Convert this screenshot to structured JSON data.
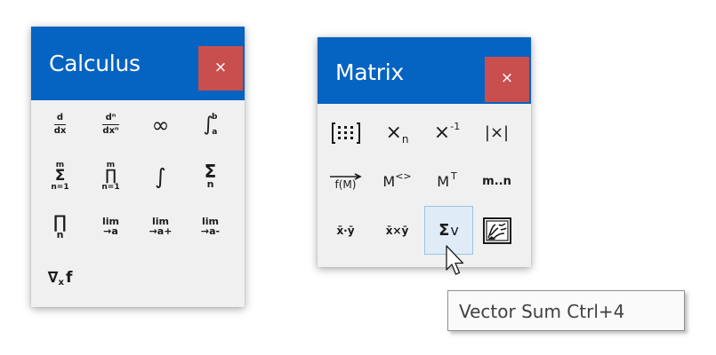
{
  "calculus": {
    "title": "Calculus",
    "close_glyph": "×",
    "buttons": [
      {
        "name": "derivative"
      },
      {
        "name": "nth-derivative"
      },
      {
        "name": "infinity"
      },
      {
        "name": "definite-integral"
      },
      {
        "name": "range-sum"
      },
      {
        "name": "range-product"
      },
      {
        "name": "indefinite-integral"
      },
      {
        "name": "summation"
      },
      {
        "name": "product"
      },
      {
        "name": "limit"
      },
      {
        "name": "right-limit"
      },
      {
        "name": "left-limit"
      },
      {
        "name": "gradient"
      }
    ],
    "glyphs": {
      "d": "d",
      "dx": "dx",
      "dn": "dⁿ",
      "dxn": "dxⁿ",
      "inf": "∞",
      "int": "∫",
      "b": "b",
      "a": "a",
      "m": "m",
      "n": "n",
      "neq1": "n=1",
      "sigma": "Σ",
      "pi": "∏",
      "lim": "lim",
      "to_a": "→a",
      "to_aplus": "→a+",
      "to_aminus": "→a-",
      "nabla": "∇",
      "x": "x",
      "f": "f"
    }
  },
  "matrix": {
    "title": "Matrix",
    "close_glyph": "×",
    "buttons": [
      {
        "name": "insert-matrix"
      },
      {
        "name": "subscript"
      },
      {
        "name": "inverse"
      },
      {
        "name": "determinant"
      },
      {
        "name": "vectorize"
      },
      {
        "name": "matrix-column"
      },
      {
        "name": "transpose"
      },
      {
        "name": "range-variable"
      },
      {
        "name": "dot-product"
      },
      {
        "name": "cross-product"
      },
      {
        "name": "vector-sum"
      },
      {
        "name": "picture"
      }
    ],
    "glyphs": {
      "xn_x": "×",
      "xn_n": "n",
      "inv_x": "×",
      "inv_sup": "-1",
      "det": "|×|",
      "fM": "f(M)",
      "M": "M",
      "col": "<>",
      "T": "T",
      "range": "m..n",
      "dot": "x̄·ȳ",
      "cross": "x̄×ȳ",
      "sigma": "Σ",
      "v": "v"
    },
    "hovered": "vector-sum"
  },
  "tooltip": {
    "text": "Vector Sum Ctrl+4"
  }
}
